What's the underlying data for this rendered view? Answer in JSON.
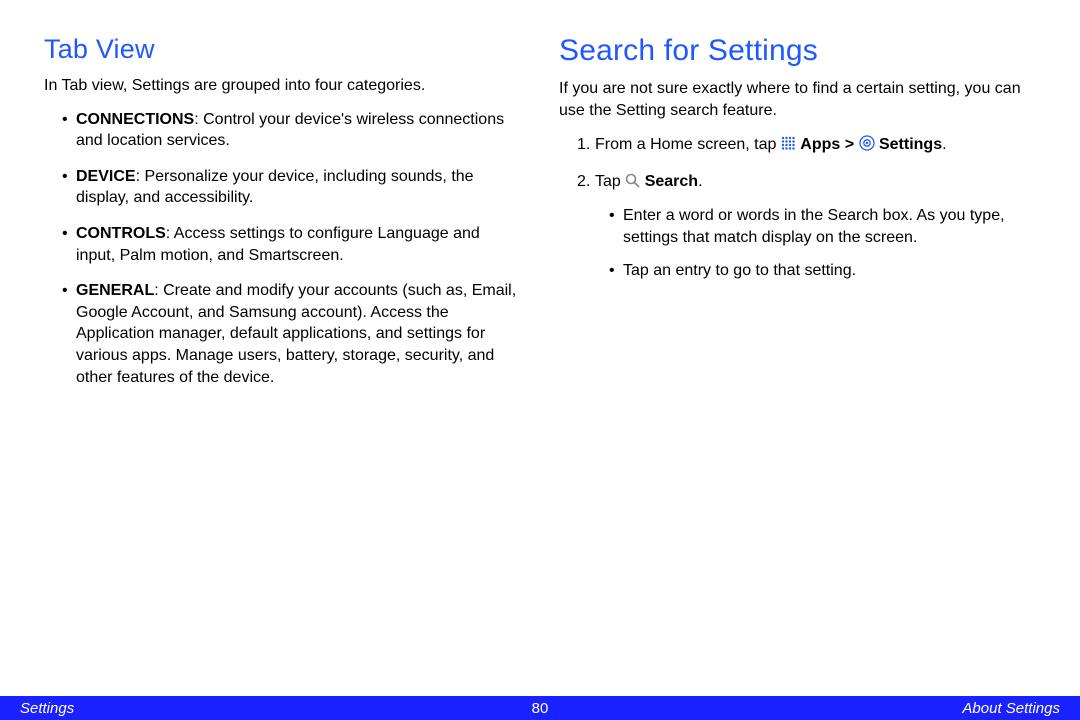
{
  "left": {
    "heading": "Tab View",
    "intro": "In Tab view, Settings are grouped into four categories.",
    "items": [
      {
        "name": "CONNECTIONS",
        "desc": ": Control your device's wireless connections and location services."
      },
      {
        "name": "DEVICE",
        "desc": ": Personalize your device, including sounds, the display, and accessibility."
      },
      {
        "name": "CONTROLS",
        "desc": ": Access settings to configure Language and input, Palm motion, and Smartscreen."
      },
      {
        "name": "GENERAL",
        "desc": ": Create and modify your accounts (such as, Email, Google Account, and Samsung account). Access the Application manager, default applications, and settings for various apps. Manage users, battery, storage, security, and other features of the device."
      }
    ]
  },
  "right": {
    "heading": "Search for Settings",
    "intro": "If you are not sure exactly where to find a certain setting, you can use the Setting search feature.",
    "step1": {
      "pre": "From a Home screen, tap ",
      "apps": "Apps",
      "sep": " > ",
      "settings": "Settings",
      "post": "."
    },
    "step2": {
      "pre": "Tap ",
      "search": "Search",
      "post": "."
    },
    "sub": [
      "Enter a word or words in the Search box. As you type, settings that match display on the screen.",
      "Tap an entry to go to that setting."
    ]
  },
  "footer": {
    "left": "Settings",
    "page": "80",
    "right": "About Settings"
  },
  "colors": {
    "accent": "#1f58ff",
    "footer": "#1a22ff"
  }
}
